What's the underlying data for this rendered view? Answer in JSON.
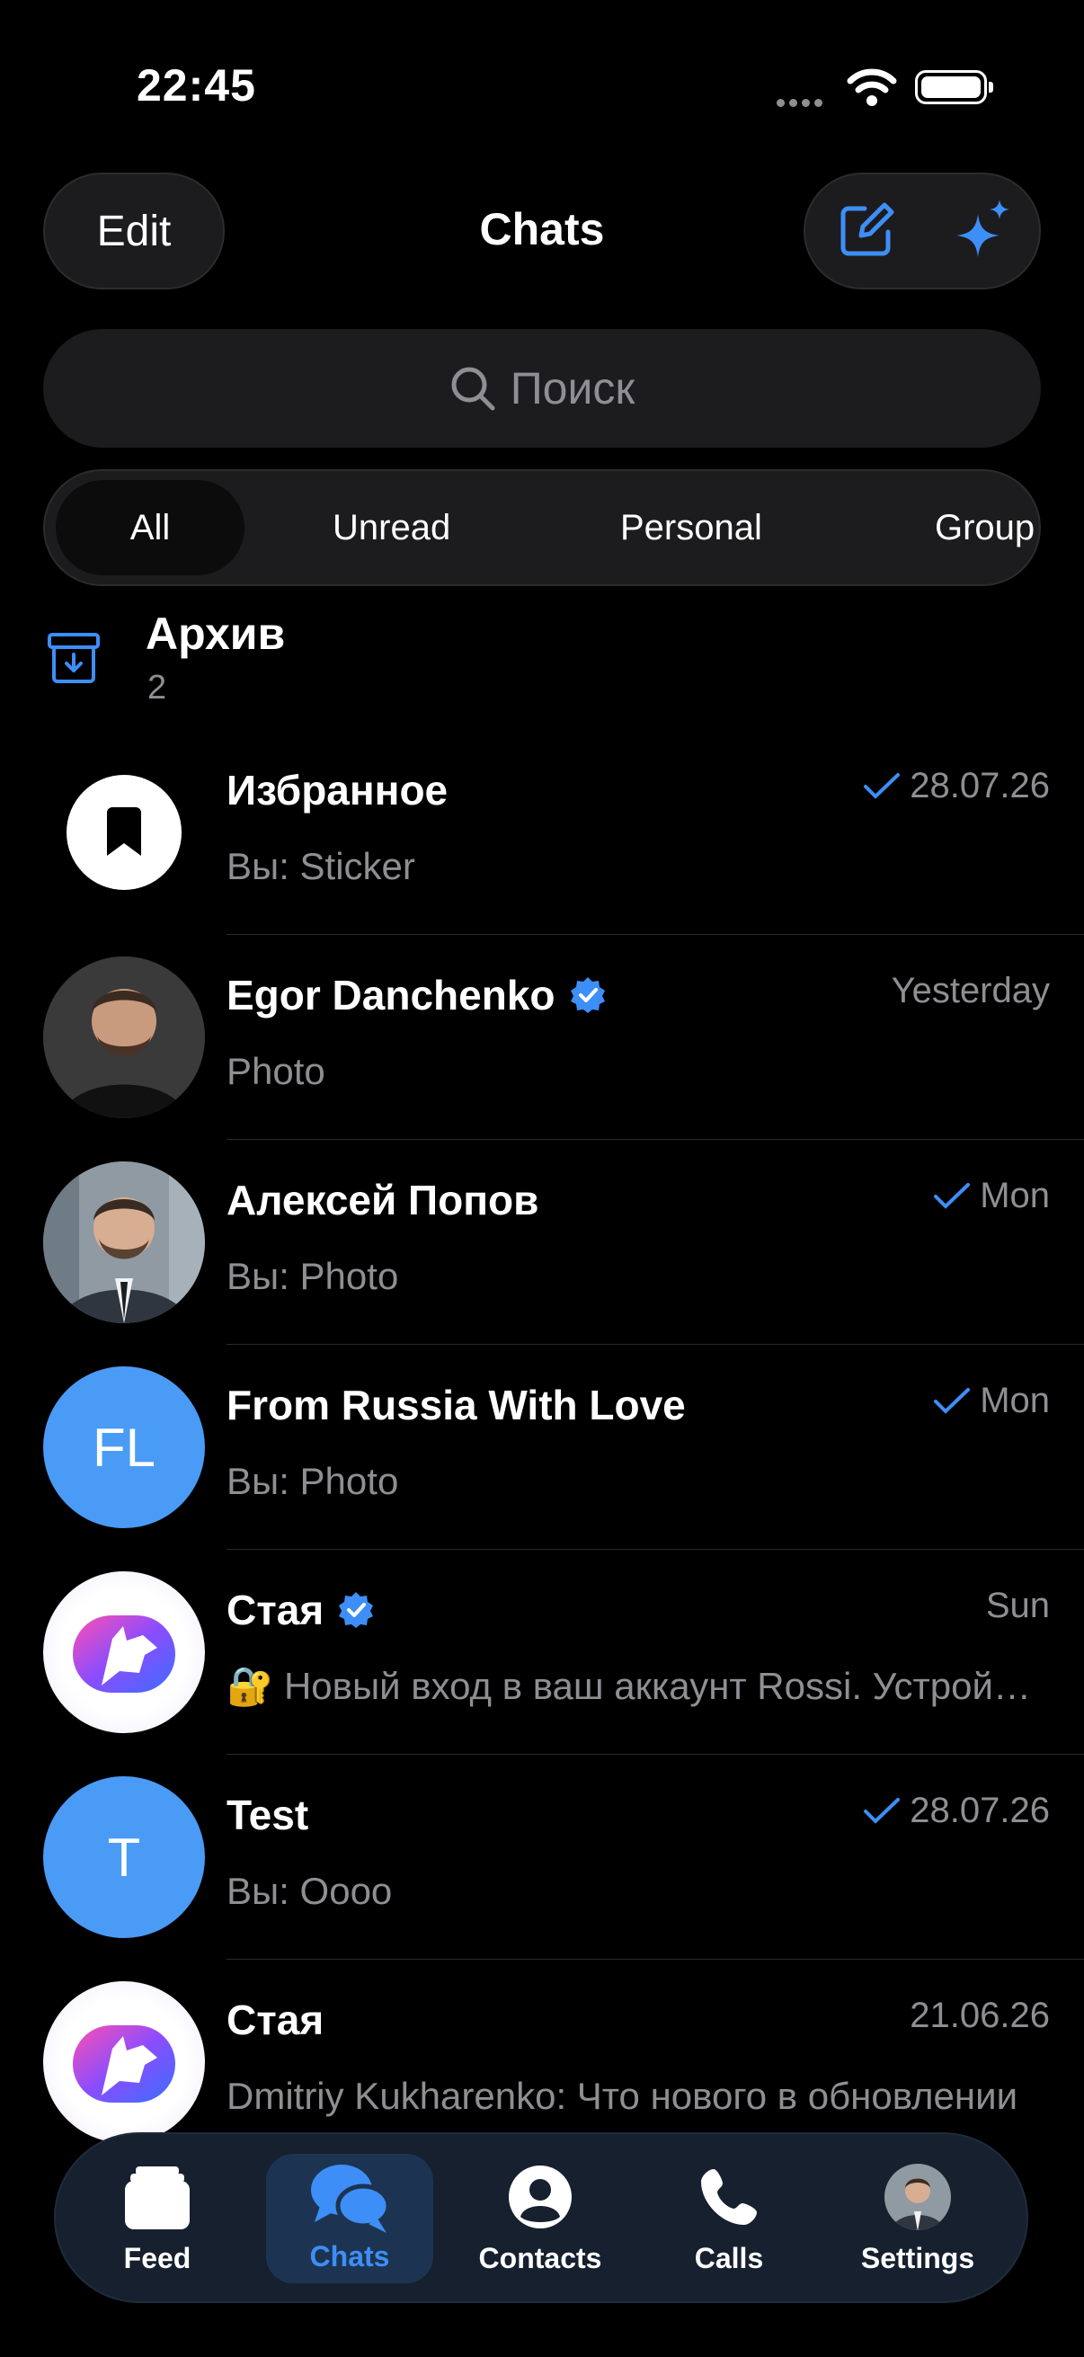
{
  "status_bar": {
    "time": "22:45"
  },
  "header": {
    "edit_label": "Edit",
    "title": "Chats"
  },
  "search": {
    "placeholder": "Поиск"
  },
  "filters": [
    "All",
    "Unread",
    "Personal",
    "Group"
  ],
  "archive": {
    "title": "Архив",
    "count": "2"
  },
  "chats": [
    {
      "name": "Избранное",
      "preview": "Вы: Sticker",
      "date": "28.07.26",
      "checked": true,
      "verified": false,
      "avatar": "saved-messages-icon"
    },
    {
      "name": "Egor Danchenko",
      "preview": "Photo",
      "date": "Yesterday",
      "checked": false,
      "verified": true,
      "avatar": "photo"
    },
    {
      "name": "Алексей Попов",
      "preview": "Вы: Photo",
      "date": "Mon",
      "checked": true,
      "verified": false,
      "avatar": "photo"
    },
    {
      "name": "From Russia With Love",
      "preview": "Вы: Photo",
      "date": "Mon",
      "checked": true,
      "verified": false,
      "avatar": "initials",
      "initials": "FL"
    },
    {
      "name": "Стая",
      "preview": "🔐 Новый вход в ваш аккаунт Rossi. Устройство",
      "date": "Sun",
      "checked": false,
      "verified": true,
      "avatar": "wolf-logo"
    },
    {
      "name": "Test",
      "preview": "Вы: Оооо",
      "date": "28.07.26",
      "checked": true,
      "verified": false,
      "avatar": "initials",
      "initials": "T"
    },
    {
      "name": "Стая",
      "preview": "Dmitriy Kukharenko: Что нового в обновлении",
      "date": "21.06.26",
      "checked": false,
      "verified": false,
      "avatar": "wolf-logo"
    }
  ],
  "tabs": [
    {
      "label": "Feed",
      "icon": "feed-icon",
      "active": false
    },
    {
      "label": "Chats",
      "icon": "chats-icon",
      "active": true
    },
    {
      "label": "Contacts",
      "icon": "contacts-icon",
      "active": false
    },
    {
      "label": "Calls",
      "icon": "calls-icon",
      "active": false
    },
    {
      "label": "Settings",
      "icon": "settings-avatar",
      "active": false
    }
  ],
  "colors": {
    "accent": "#3e8ef7",
    "avatar_blue": "#4a9bf6",
    "muted": "#8e8e93",
    "background": "#000000"
  }
}
